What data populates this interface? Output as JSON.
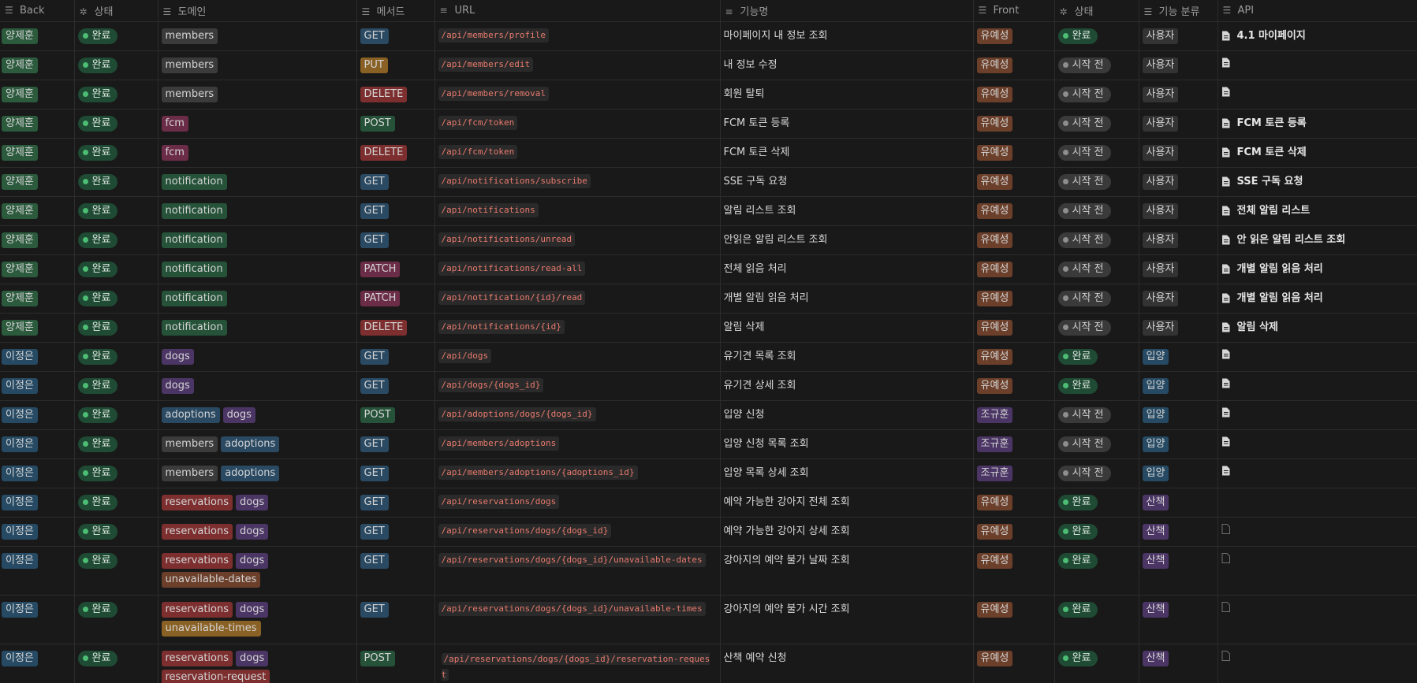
{
  "headers": [
    {
      "label": "Back",
      "icon": "list-icon"
    },
    {
      "label": "상태",
      "icon": "status-icon"
    },
    {
      "label": "도메인",
      "icon": "list-icon"
    },
    {
      "label": "메서드",
      "icon": "list-icon"
    },
    {
      "label": "URL",
      "icon": "text-icon"
    },
    {
      "label": "기능명",
      "icon": "text-icon"
    },
    {
      "label": "Front",
      "icon": "list-icon"
    },
    {
      "label": "상태",
      "icon": "status-icon"
    },
    {
      "label": "기능 분류",
      "icon": "list-icon"
    },
    {
      "label": "API",
      "icon": "list-icon"
    }
  ],
  "colors": {
    "owner": {
      "양제훈": "#2b5a3d",
      "이정은": "#264a63"
    },
    "front": {
      "유예성": "#6b3f2a",
      "조규훈": "#4b3565"
    },
    "method": {
      "GET": "#2a4a63",
      "PUT": "#8a6125",
      "DELETE": "#7d2f2f",
      "POST": "#255238",
      "PATCH": "#6b2c48"
    },
    "domain": {
      "members": "#3b3b3b",
      "fcm": "#6b2c48",
      "notification": "#255238",
      "dogs": "#4b3565",
      "adoptions": "#2a4a63",
      "reservations": "#7d2f2f",
      "unavailable-dates": "#6b3f2a",
      "unavailable-times": "#8a6125",
      "reservation-request": "#7d2f2f"
    },
    "category": {
      "사용자": "#333333",
      "입양": "#264a63",
      "산책": "#4b3565"
    }
  },
  "rows": [
    {
      "back": "양제훈",
      "status": "완료",
      "domains": [
        "members"
      ],
      "method": "GET",
      "url": "/api/members/profile",
      "feature": "마이페이지 내 정보 조회",
      "front": "유예성",
      "fstatus": "완료",
      "category": "사용자",
      "api": "4.1 마이페이지",
      "api_icon": "doc-filled-icon"
    },
    {
      "back": "양제훈",
      "status": "완료",
      "domains": [
        "members"
      ],
      "method": "PUT",
      "url": "/api/members/edit",
      "feature": "내 정보 수정",
      "front": "유예성",
      "fstatus": "시작 전",
      "category": "사용자",
      "api": "",
      "api_icon": "doc-filled-icon"
    },
    {
      "back": "양제훈",
      "status": "완료",
      "domains": [
        "members"
      ],
      "method": "DELETE",
      "url": "/api/members/removal",
      "feature": "회원 탈퇴",
      "front": "유예성",
      "fstatus": "시작 전",
      "category": "사용자",
      "api": "",
      "api_icon": "doc-filled-icon"
    },
    {
      "back": "양제훈",
      "status": "완료",
      "domains": [
        "fcm"
      ],
      "method": "POST",
      "url": "/api/fcm/token",
      "feature": "FCM 토큰 등록",
      "front": "유예성",
      "fstatus": "시작 전",
      "category": "사용자",
      "api": "FCM 토큰 등록",
      "api_icon": "doc-filled-icon"
    },
    {
      "back": "양제훈",
      "status": "완료",
      "domains": [
        "fcm"
      ],
      "method": "DELETE",
      "url": "/api/fcm/token",
      "feature": "FCM 토큰 삭제",
      "front": "유예성",
      "fstatus": "시작 전",
      "category": "사용자",
      "api": "FCM 토큰 삭제",
      "api_icon": "doc-filled-icon"
    },
    {
      "back": "양제훈",
      "status": "완료",
      "domains": [
        "notification"
      ],
      "method": "GET",
      "url": "/api/notifications/subscribe",
      "feature": "SSE 구독 요청",
      "front": "유예성",
      "fstatus": "시작 전",
      "category": "사용자",
      "api": "SSE 구독 요청",
      "api_icon": "doc-filled-icon"
    },
    {
      "back": "양제훈",
      "status": "완료",
      "domains": [
        "notification"
      ],
      "method": "GET",
      "url": "/api/notifications",
      "feature": "알림 리스트 조회",
      "front": "유예성",
      "fstatus": "시작 전",
      "category": "사용자",
      "api": "전체 알림 리스트",
      "api_icon": "doc-filled-icon"
    },
    {
      "back": "양제훈",
      "status": "완료",
      "domains": [
        "notification"
      ],
      "method": "GET",
      "url": "/api/notifications/unread",
      "feature": "안읽은 알림 리스트 조회",
      "front": "유예성",
      "fstatus": "시작 전",
      "category": "사용자",
      "api": "안 읽은 알림 리스트 조회",
      "api_icon": "doc-filled-icon"
    },
    {
      "back": "양제훈",
      "status": "완료",
      "domains": [
        "notification"
      ],
      "method": "PATCH",
      "url": "/api/notifications/read-all",
      "feature": "전체 읽음 처리",
      "front": "유예성",
      "fstatus": "시작 전",
      "category": "사용자",
      "api": "개별 알림 읽음 처리",
      "api_icon": "doc-filled-icon"
    },
    {
      "back": "양제훈",
      "status": "완료",
      "domains": [
        "notification"
      ],
      "method": "PATCH",
      "url": "/api/notification/{id}/read",
      "feature": "개별 알림 읽음 처리",
      "front": "유예성",
      "fstatus": "시작 전",
      "category": "사용자",
      "api": "개별 알림 읽음 처리",
      "api_icon": "doc-filled-icon"
    },
    {
      "back": "양제훈",
      "status": "완료",
      "domains": [
        "notification"
      ],
      "method": "DELETE",
      "url": "/api/notifications/{id}",
      "feature": "알림 삭제",
      "front": "유예성",
      "fstatus": "시작 전",
      "category": "사용자",
      "api": "알림 삭제",
      "api_icon": "doc-filled-icon"
    },
    {
      "back": "이정은",
      "status": "완료",
      "domains": [
        "dogs"
      ],
      "method": "GET",
      "url": "/api/dogs",
      "feature": "유기견 목록 조회",
      "front": "유예성",
      "fstatus": "완료",
      "category": "입양",
      "api": "",
      "api_icon": "doc-filled-icon"
    },
    {
      "back": "이정은",
      "status": "완료",
      "domains": [
        "dogs"
      ],
      "method": "GET",
      "url": "/api/dogs/{dogs_id}",
      "feature": "유기견 상세 조회",
      "front": "유예성",
      "fstatus": "완료",
      "category": "입양",
      "api": "",
      "api_icon": "doc-filled-icon"
    },
    {
      "back": "이정은",
      "status": "완료",
      "domains": [
        "adoptions",
        "dogs"
      ],
      "method": "POST",
      "url": "/api/adoptions/dogs/{dogs_id}",
      "feature": "입양 신청",
      "front": "조규훈",
      "fstatus": "시작 전",
      "category": "입양",
      "api": "",
      "api_icon": "doc-filled-icon"
    },
    {
      "back": "이정은",
      "status": "완료",
      "domains": [
        "members",
        "adoptions"
      ],
      "method": "GET",
      "url": "/api/members/adoptions",
      "feature": "입양 신청 목록 조회",
      "front": "조규훈",
      "fstatus": "시작 전",
      "category": "입양",
      "api": "",
      "api_icon": "doc-filled-icon"
    },
    {
      "back": "이정은",
      "status": "완료",
      "domains": [
        "members",
        "adoptions"
      ],
      "method": "GET",
      "url": "/api/members/adoptions/{adoptions_id}",
      "feature": "입양 목록 상세 조회",
      "front": "조규훈",
      "fstatus": "시작 전",
      "category": "입양",
      "api": "",
      "api_icon": "doc-filled-icon"
    },
    {
      "back": "이정은",
      "status": "완료",
      "domains": [
        "reservations",
        "dogs"
      ],
      "method": "GET",
      "url": "/api/reservations/dogs",
      "feature": "예약 가능한 강아지 전체 조회",
      "front": "유예성",
      "fstatus": "완료",
      "category": "산책",
      "api": "",
      "api_icon": "none"
    },
    {
      "back": "이정은",
      "status": "완료",
      "domains": [
        "reservations",
        "dogs"
      ],
      "method": "GET",
      "url": "/api/reservations/dogs/{dogs_id}",
      "feature": "예약 가능한 강아지 상세 조회",
      "front": "유예성",
      "fstatus": "완료",
      "category": "산책",
      "api": "",
      "api_icon": "doc-outline-icon"
    },
    {
      "back": "이정은",
      "status": "완료",
      "domains": [
        "reservations",
        "dogs",
        "unavailable-dates"
      ],
      "method": "GET",
      "url": "/api/reservations/dogs/{dogs_id}/unavailable-dates",
      "feature": "강아지의 예약 불가 날짜 조회",
      "front": "유예성",
      "fstatus": "완료",
      "category": "산책",
      "api": "",
      "api_icon": "doc-outline-icon",
      "tall": true
    },
    {
      "back": "이정은",
      "status": "완료",
      "domains": [
        "reservations",
        "dogs",
        "unavailable-times"
      ],
      "method": "GET",
      "url": "/api/reservations/dogs/{dogs_id}/unavailable-times",
      "feature": "강아지의 예약 불가 시간 조회",
      "front": "유예성",
      "fstatus": "완료",
      "category": "산책",
      "api": "",
      "api_icon": "doc-outline-icon",
      "tall": true
    },
    {
      "back": "이정은",
      "status": "완료",
      "domains": [
        "reservations",
        "dogs",
        "reservation-request"
      ],
      "method": "POST",
      "url": "/api/reservations/dogs/{dogs_id}/reservation-request",
      "feature": "산책 예약 신청",
      "front": "유예성",
      "fstatus": "완료",
      "category": "산책",
      "api": "",
      "api_icon": "doc-outline-icon",
      "tall": true,
      "url_wrap": true
    }
  ]
}
